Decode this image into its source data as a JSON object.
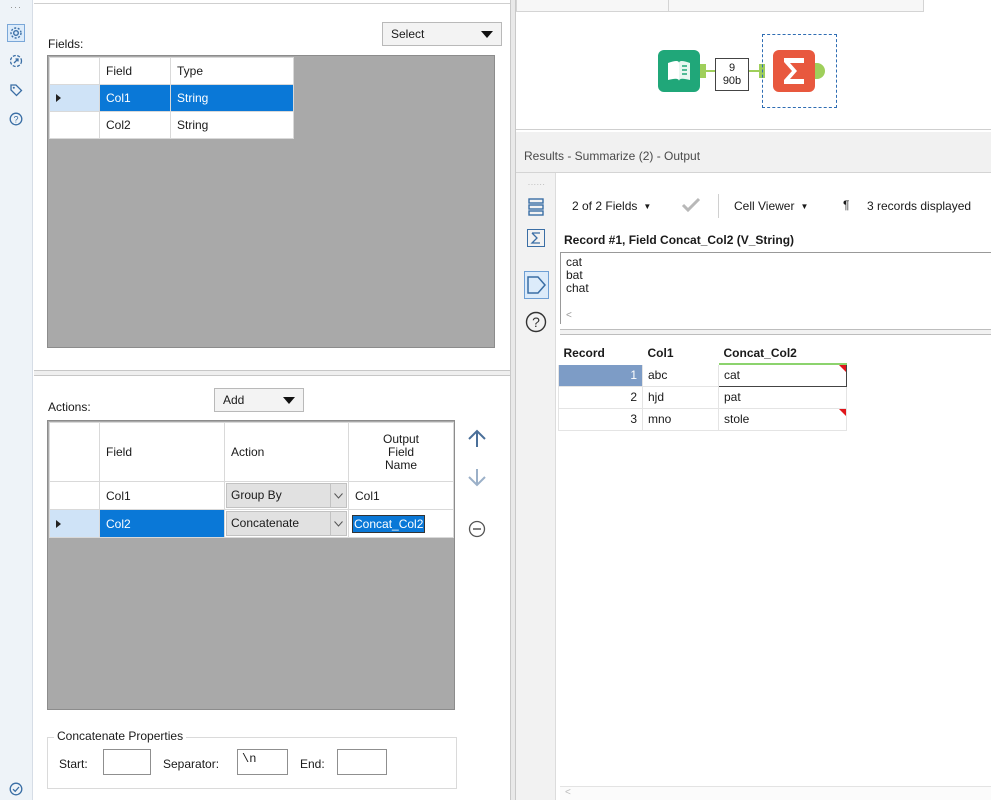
{
  "rail": {
    "icons": [
      "gear-icon",
      "annotation-icon",
      "tag-icon",
      "help-icon"
    ],
    "bottom_icon": "check-circle-icon"
  },
  "config": {
    "fields_label": "Fields:",
    "select_button": "Select",
    "fields_table": {
      "headers": [
        "Field",
        "Type"
      ],
      "rows": [
        {
          "field": "Col1",
          "type": "String"
        },
        {
          "field": "Col2",
          "type": "String"
        }
      ]
    },
    "actions_label": "Actions:",
    "add_button": "Add",
    "actions_table": {
      "headers": [
        "Field",
        "Action",
        "Output Field Name"
      ],
      "header_output_lines": [
        "Output",
        "Field",
        "Name"
      ],
      "rows": [
        {
          "field": "Col1",
          "action": "Group By",
          "output": "Col1"
        },
        {
          "field": "Col2",
          "action": "Concatenate",
          "output": "Concat_Col2"
        }
      ]
    },
    "concat": {
      "title": "Concatenate Properties",
      "start_label": "Start:",
      "start_value": "",
      "separator_label": "Separator:",
      "separator_value": "\\n",
      "end_label": "End:",
      "end_value": ""
    }
  },
  "canvas": {
    "connector_top": "9",
    "connector_bottom": "90b"
  },
  "results": {
    "title": "Results - Summarize (2) - Output",
    "fields_count": "2 of 2 Fields",
    "cell_viewer": "Cell Viewer",
    "records_displayed": "3 records displayed",
    "record_header": "Record #1, Field Concat_Col2 (V_String)",
    "cell_lines": [
      "cat",
      "bat",
      "chat"
    ],
    "table": {
      "headers": [
        "Record",
        "Col1",
        "Concat_Col2"
      ],
      "rows": [
        {
          "record": "1",
          "col1": "abc",
          "concat": "cat"
        },
        {
          "record": "2",
          "col1": "hjd",
          "concat": "pat"
        },
        {
          "record": "3",
          "col1": "mno",
          "concat": "stole"
        }
      ]
    }
  }
}
